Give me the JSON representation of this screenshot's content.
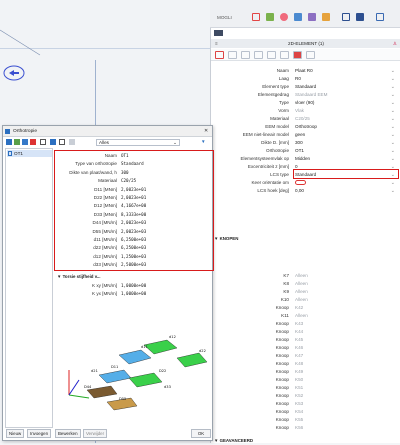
{
  "topbar": {
    "mode_label": "MOGLI"
  },
  "panel": {
    "title": "2D-ELEMENT (1)",
    "rows": [
      {
        "label": "Naam",
        "value": "Plaat R0"
      },
      {
        "label": "Laag",
        "value": "R0"
      },
      {
        "label": "Element type",
        "value": "Standaard"
      },
      {
        "label": "Elementgedrag",
        "value": "Standaard EEM",
        "grey": true
      },
      {
        "label": "Type",
        "value": "vloer (90)"
      },
      {
        "label": "Vorm",
        "value": "Vlak",
        "grey": true
      },
      {
        "label": "Materiaal",
        "value": "C20/25",
        "grey": true
      },
      {
        "label": "EEM model",
        "value": "Orthotroop"
      },
      {
        "label": "EEM niet-lineair model",
        "value": "geen"
      },
      {
        "label": "Dikte D. [mm]",
        "value": "300"
      },
      {
        "label": "Orthotropie",
        "value": "OT1"
      },
      {
        "label": "Elementsysteemvlak op",
        "value": "Midden"
      },
      {
        "label": "Excentriciteit z [mm]",
        "value": "0"
      },
      {
        "label": "LCS type",
        "value": "Standaard"
      },
      {
        "label": "Keer oriëntatie om",
        "value": ""
      },
      {
        "label": "LCS hoek [deg]",
        "value": "0,00"
      }
    ],
    "section_knopen": "KNOPEN",
    "knopen": [
      {
        "label": "K7",
        "value": "Alleen"
      },
      {
        "label": "K8",
        "value": "Alleen"
      },
      {
        "label": "K9",
        "value": "Alleen"
      },
      {
        "label": "K10",
        "value": "Alleen"
      },
      {
        "label": "Knoop",
        "value": "K42"
      },
      {
        "label": "K11",
        "value": "Alleen"
      },
      {
        "label": "Knoop",
        "value": "K43"
      },
      {
        "label": "Knoop",
        "value": "K44"
      },
      {
        "label": "Knoop",
        "value": "K45"
      },
      {
        "label": "Knoop",
        "value": "K46"
      },
      {
        "label": "Knoop",
        "value": "K47"
      },
      {
        "label": "Knoop",
        "value": "K48"
      },
      {
        "label": "Knoop",
        "value": "K49"
      },
      {
        "label": "Knoop",
        "value": "K50"
      },
      {
        "label": "Knoop",
        "value": "K51"
      },
      {
        "label": "Knoop",
        "value": "K52"
      },
      {
        "label": "Knoop",
        "value": "K53"
      },
      {
        "label": "Knoop",
        "value": "K54"
      },
      {
        "label": "Knoop",
        "value": "K55"
      },
      {
        "label": "Knoop",
        "value": "K56"
      }
    ],
    "section_bottom": "GEAVANCEERD"
  },
  "dialog": {
    "title": "Orthotropie",
    "filter": "Alles",
    "list": [
      "OT1"
    ],
    "rows": [
      {
        "label": "Naam",
        "value": "OT1"
      },
      {
        "label": "Type van orthotropie",
        "value": "Standaard"
      },
      {
        "label": "Dikte van plaat/wand, h",
        "value": "300"
      },
      {
        "label": "Materiaal",
        "value": "C20/25"
      },
      {
        "label": "D11 [MNm]",
        "value": "2,0023e+01"
      },
      {
        "label": "D22 [MNm]",
        "value": "2,0023e+01"
      },
      {
        "label": "D12 [MNm]",
        "value": "4,1667e+00"
      },
      {
        "label": "D33 [MNm]",
        "value": "8,3333e+00"
      },
      {
        "label": "D44 [MN/m]",
        "value": "2,0023e+03"
      },
      {
        "label": "D55 [MN/m]",
        "value": "2,0023e+03"
      },
      {
        "label": "d11 [MN/m]",
        "value": "6,2500e+03"
      },
      {
        "label": "d22 [MN/m]",
        "value": "6,2500e+03"
      },
      {
        "label": "d12 [MN/m]",
        "value": "1,2500e+03"
      },
      {
        "label": "d33 [MN/m]",
        "value": "2,5000e+03"
      }
    ],
    "section": "Torsie stijfheid v...",
    "extra": [
      {
        "label": "K xy [MN/m]",
        "value": "1,0000e+00"
      },
      {
        "label": "K yx [MN/m]",
        "value": "1,0000e+00"
      }
    ],
    "figure_labels": [
      "d11",
      "d12",
      "d22",
      "d21",
      "D11",
      "D22",
      "D44",
      "D55",
      "d33"
    ],
    "buttons": {
      "new": "Nieuw",
      "insert": "Invoegen",
      "edit": "Bewerken",
      "delete": "Verwijder",
      "ok": "OK"
    }
  }
}
